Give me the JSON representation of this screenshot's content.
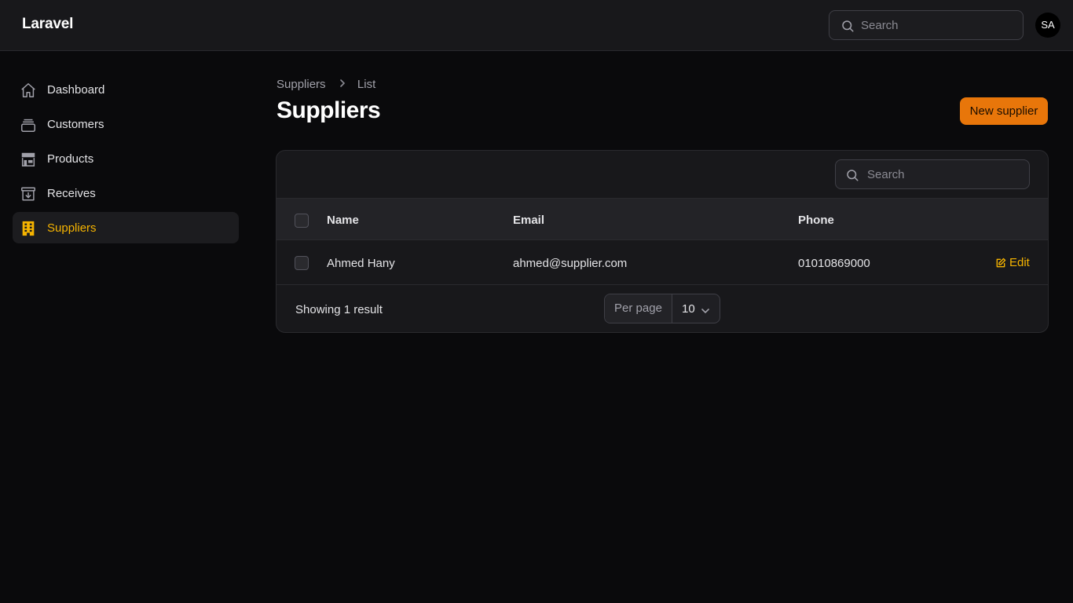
{
  "header": {
    "brand": "Laravel",
    "search_placeholder": "Search",
    "avatar_initials": "SA"
  },
  "sidebar": {
    "items": [
      {
        "label": "Dashboard",
        "icon": "home-icon",
        "active": false
      },
      {
        "label": "Customers",
        "icon": "collection-icon",
        "active": false
      },
      {
        "label": "Products",
        "icon": "storefront-icon",
        "active": false
      },
      {
        "label": "Receives",
        "icon": "archive-download-icon",
        "active": false
      },
      {
        "label": "Suppliers",
        "icon": "building-icon",
        "active": true
      }
    ]
  },
  "breadcrumb": {
    "items": [
      "Suppliers",
      "List"
    ]
  },
  "page": {
    "title": "Suppliers",
    "new_button": "New supplier"
  },
  "table": {
    "search_placeholder": "Search",
    "columns": [
      "Name",
      "Email",
      "Phone"
    ],
    "rows": [
      {
        "name": "Ahmed Hany",
        "email": "ahmed@supplier.com",
        "phone": "01010869000",
        "action": "Edit"
      }
    ],
    "footer": {
      "summary": "Showing 1 result",
      "per_page_label": "Per page",
      "per_page_value": "10"
    }
  },
  "colors": {
    "accent": "#f5b300",
    "primary_button": "#e8760a",
    "background": "#0a0a0c",
    "surface": "#18181b"
  }
}
